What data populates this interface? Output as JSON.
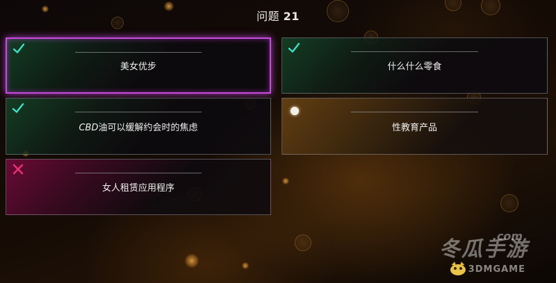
{
  "quiz": {
    "title_prefix": "问题",
    "question_number": "21"
  },
  "answers": [
    {
      "label_prefix": "",
      "label": "美女优步",
      "status": "correct",
      "selected": true,
      "icon": "check-icon"
    },
    {
      "label_prefix": "",
      "label": "什么什么零食",
      "status": "correct",
      "selected": false,
      "icon": "check-icon"
    },
    {
      "label_prefix": "CBD",
      "label": "油可以缓解约会时的焦虑",
      "status": "correct",
      "selected": false,
      "icon": "check-icon"
    },
    {
      "label_prefix": "",
      "label": "性教育产品",
      "status": "pending",
      "selected": false,
      "icon": "dot-icon"
    },
    {
      "label_prefix": "",
      "label": "女人租赁应用程序",
      "status": "wrong",
      "selected": false,
      "icon": "cross-icon"
    }
  ],
  "watermark": {
    "brand_cn": "冬瓜手游",
    "domain": ".com",
    "brand_en": "3DMGAME"
  },
  "colors": {
    "check": "#3fe0c8",
    "cross": "#e8307a",
    "selected_border": "#c94ae0",
    "bokeh": "#d99a45"
  }
}
